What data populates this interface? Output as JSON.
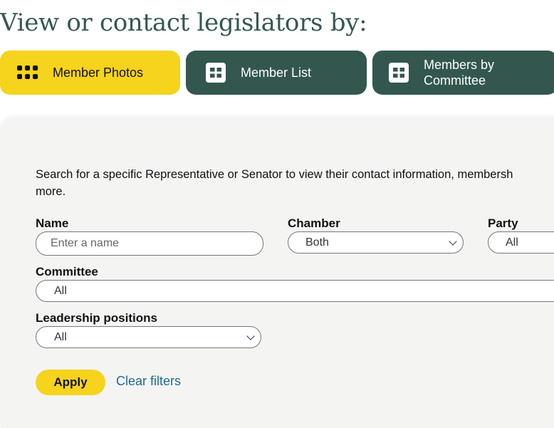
{
  "page": {
    "title": "View or contact legislators by:"
  },
  "view_options": [
    {
      "label": "Member Photos",
      "icon": "dots-grid-icon",
      "selected": true
    },
    {
      "label": "Member List",
      "icon": "table-grid-icon",
      "selected": false
    },
    {
      "label": "Members by Committee",
      "icon": "table-grid-icon",
      "selected": false
    }
  ],
  "search": {
    "intro_line1": "Search for a specific Representative or Senator to view their contact information, membersh",
    "intro_line2": "more.",
    "name": {
      "label": "Name",
      "placeholder": "Enter a name"
    },
    "chamber": {
      "label": "Chamber",
      "value": "Both"
    },
    "party": {
      "label": "Party",
      "value": "All"
    },
    "committee": {
      "label": "Committee",
      "value": "All"
    },
    "leadership": {
      "label": "Leadership positions",
      "value": "All"
    },
    "apply_label": "Apply",
    "clear_label": "Clear filters"
  },
  "colors": {
    "yellow": "#f6d31c",
    "dark_green": "#33574f",
    "title_green": "#355752",
    "panel_bg": "#f4f4f3",
    "link_blue": "#1d6a99"
  }
}
